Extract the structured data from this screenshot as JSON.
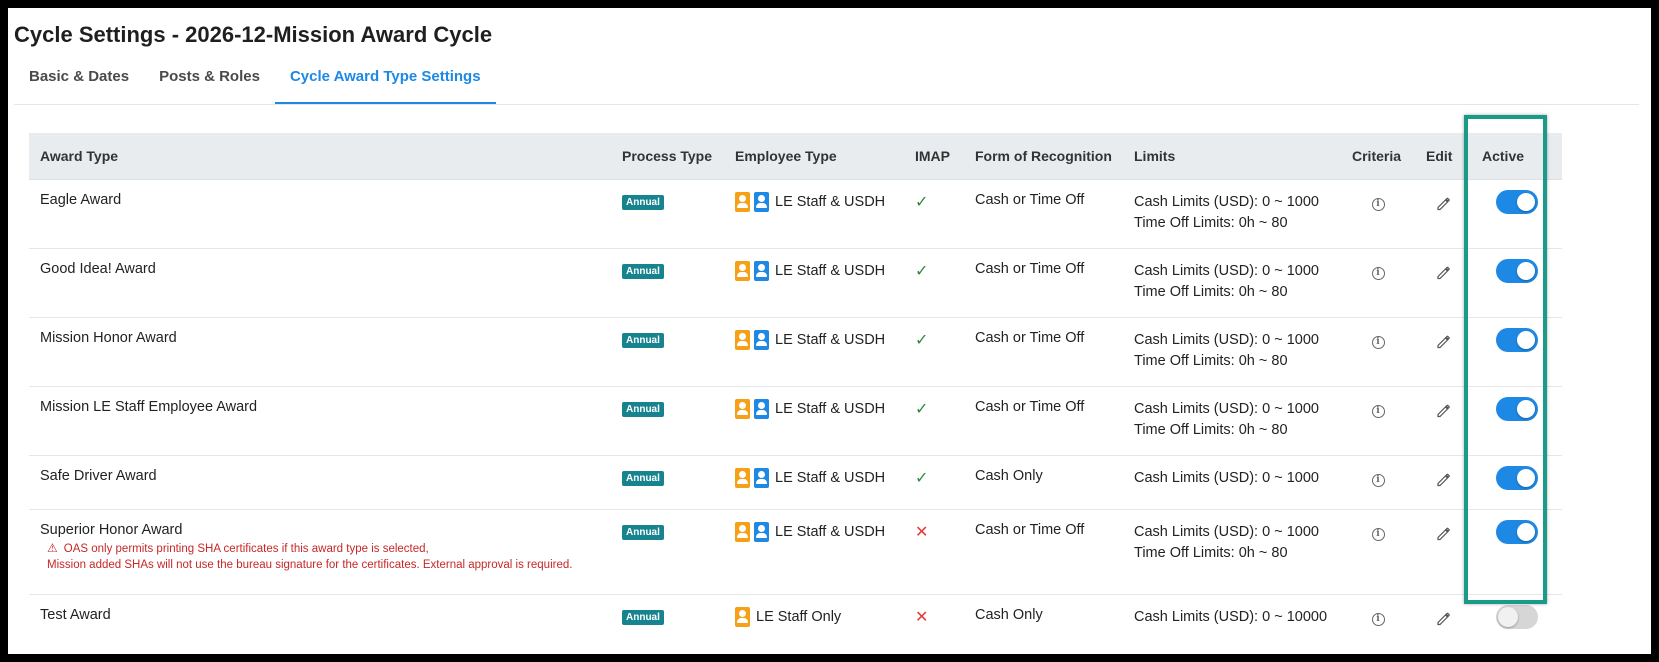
{
  "page": {
    "title": "Cycle Settings - 2026-12-Mission Award Cycle"
  },
  "tabs": [
    {
      "label": "Basic & Dates",
      "active": false
    },
    {
      "label": "Posts & Roles",
      "active": false
    },
    {
      "label": "Cycle Award Type Settings",
      "active": true
    }
  ],
  "table": {
    "headers": {
      "award_type": "Award Type",
      "process_type": "Process Type",
      "employee_type": "Employee Type",
      "imap": "IMAP",
      "form": "Form of Recognition",
      "limits": "Limits",
      "criteria": "Criteria",
      "edit": "Edit",
      "active": "Active"
    },
    "rows": [
      {
        "award_type": "Eagle Award",
        "process_type": "Annual",
        "employee_icons": [
          "orange-person-icon",
          "blue-person-icon"
        ],
        "employee_type": "LE Staff & USDH",
        "imap": "check",
        "form": "Cash or Time Off",
        "cash_limit": "Cash Limits (USD): 0 ~ 1000",
        "time_off_limit": "Time Off Limits: 0h ~ 80",
        "active": true
      },
      {
        "award_type": "Good Idea! Award",
        "process_type": "Annual",
        "employee_icons": [
          "orange-person-icon",
          "blue-person-icon"
        ],
        "employee_type": "LE Staff & USDH",
        "imap": "check",
        "form": "Cash or Time Off",
        "cash_limit": "Cash Limits (USD): 0 ~ 1000",
        "time_off_limit": "Time Off Limits: 0h ~ 80",
        "active": true
      },
      {
        "award_type": "Mission Honor Award",
        "process_type": "Annual",
        "employee_icons": [
          "orange-person-icon",
          "blue-person-icon"
        ],
        "employee_type": "LE Staff & USDH",
        "imap": "check",
        "form": "Cash or Time Off",
        "cash_limit": "Cash Limits (USD): 0 ~ 1000",
        "time_off_limit": "Time Off Limits: 0h ~ 80",
        "active": true
      },
      {
        "award_type": "Mission LE Staff Employee Award",
        "process_type": "Annual",
        "employee_icons": [
          "orange-person-icon",
          "blue-person-icon"
        ],
        "employee_type": "LE Staff & USDH",
        "imap": "check",
        "form": "Cash or Time Off",
        "cash_limit": "Cash Limits (USD): 0 ~ 1000",
        "time_off_limit": "Time Off Limits: 0h ~ 80",
        "active": true
      },
      {
        "award_type": "Safe Driver Award",
        "process_type": "Annual",
        "employee_icons": [
          "orange-person-icon",
          "blue-person-icon"
        ],
        "employee_type": "LE Staff & USDH",
        "imap": "check",
        "form": "Cash Only",
        "cash_limit": "Cash Limits (USD): 0 ~ 1000",
        "time_off_limit": "",
        "active": true
      },
      {
        "award_type": "Superior Honor Award",
        "warning_line1": "OAS only permits printing SHA certificates if this award type is selected,",
        "warning_line2": "Mission added SHAs will not use the bureau signature for the certificates. External approval is required.",
        "process_type": "Annual",
        "employee_icons": [
          "orange-person-icon",
          "blue-person-icon"
        ],
        "employee_type": "LE Staff & USDH",
        "imap": "cross",
        "form": "Cash or Time Off",
        "cash_limit": "Cash Limits (USD): 0 ~ 1000",
        "time_off_limit": "Time Off Limits: 0h ~ 80",
        "active": true
      },
      {
        "award_type": "Test Award",
        "process_type": "Annual",
        "employee_icons": [
          "orange-person-icon"
        ],
        "employee_type": "LE Staff Only",
        "imap": "cross",
        "form": "Cash Only",
        "cash_limit": "Cash Limits (USD): 0 ~ 10000",
        "time_off_limit": "",
        "active": false
      }
    ]
  },
  "icons": {
    "check": "✓",
    "cross": "✕",
    "warning": "⚠",
    "info": "i"
  },
  "colors": {
    "accent": "#1e88e5",
    "badge": "#17838f",
    "highlight_border": "#1a9a89",
    "warning_text": "#c62828",
    "check": "#2e8b3e",
    "cross": "#e53935"
  }
}
